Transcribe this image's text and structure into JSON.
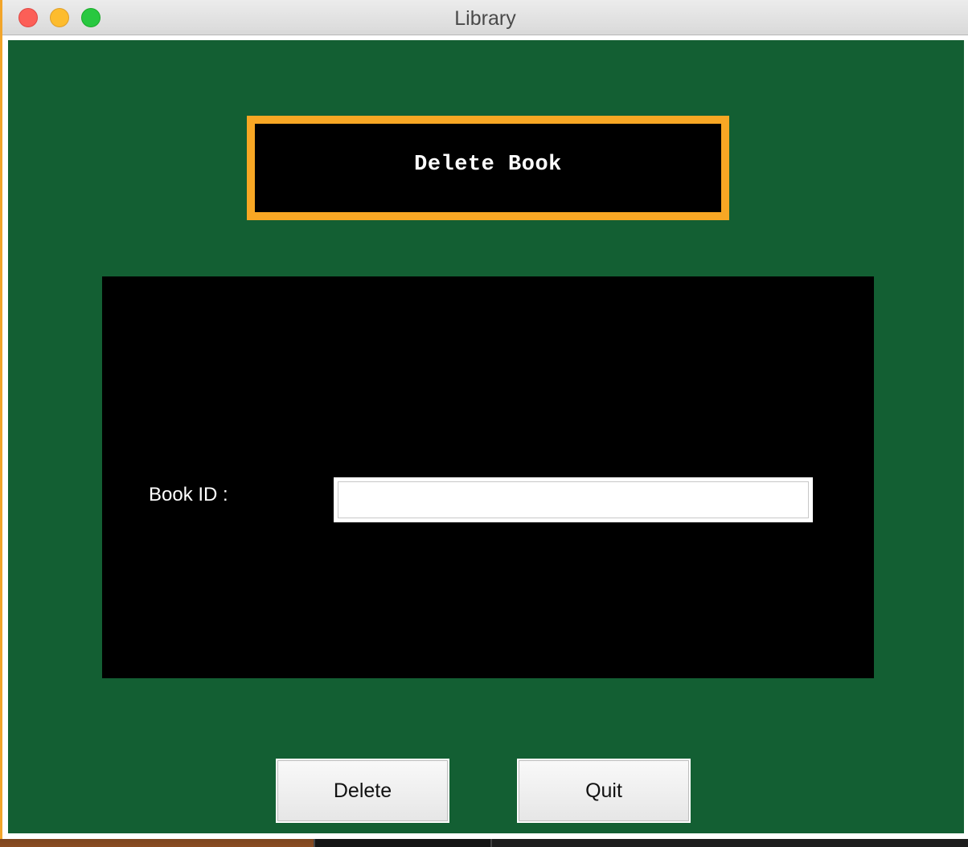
{
  "window": {
    "title": "Library"
  },
  "heading": {
    "text": "Delete Book"
  },
  "form": {
    "book_id_label": "Book ID :",
    "book_id_value": "",
    "book_id_placeholder": ""
  },
  "buttons": {
    "delete_label": "Delete",
    "quit_label": "Quit"
  },
  "colors": {
    "background": "#135f33",
    "heading_border": "#f8a724",
    "panel": "#000000"
  }
}
